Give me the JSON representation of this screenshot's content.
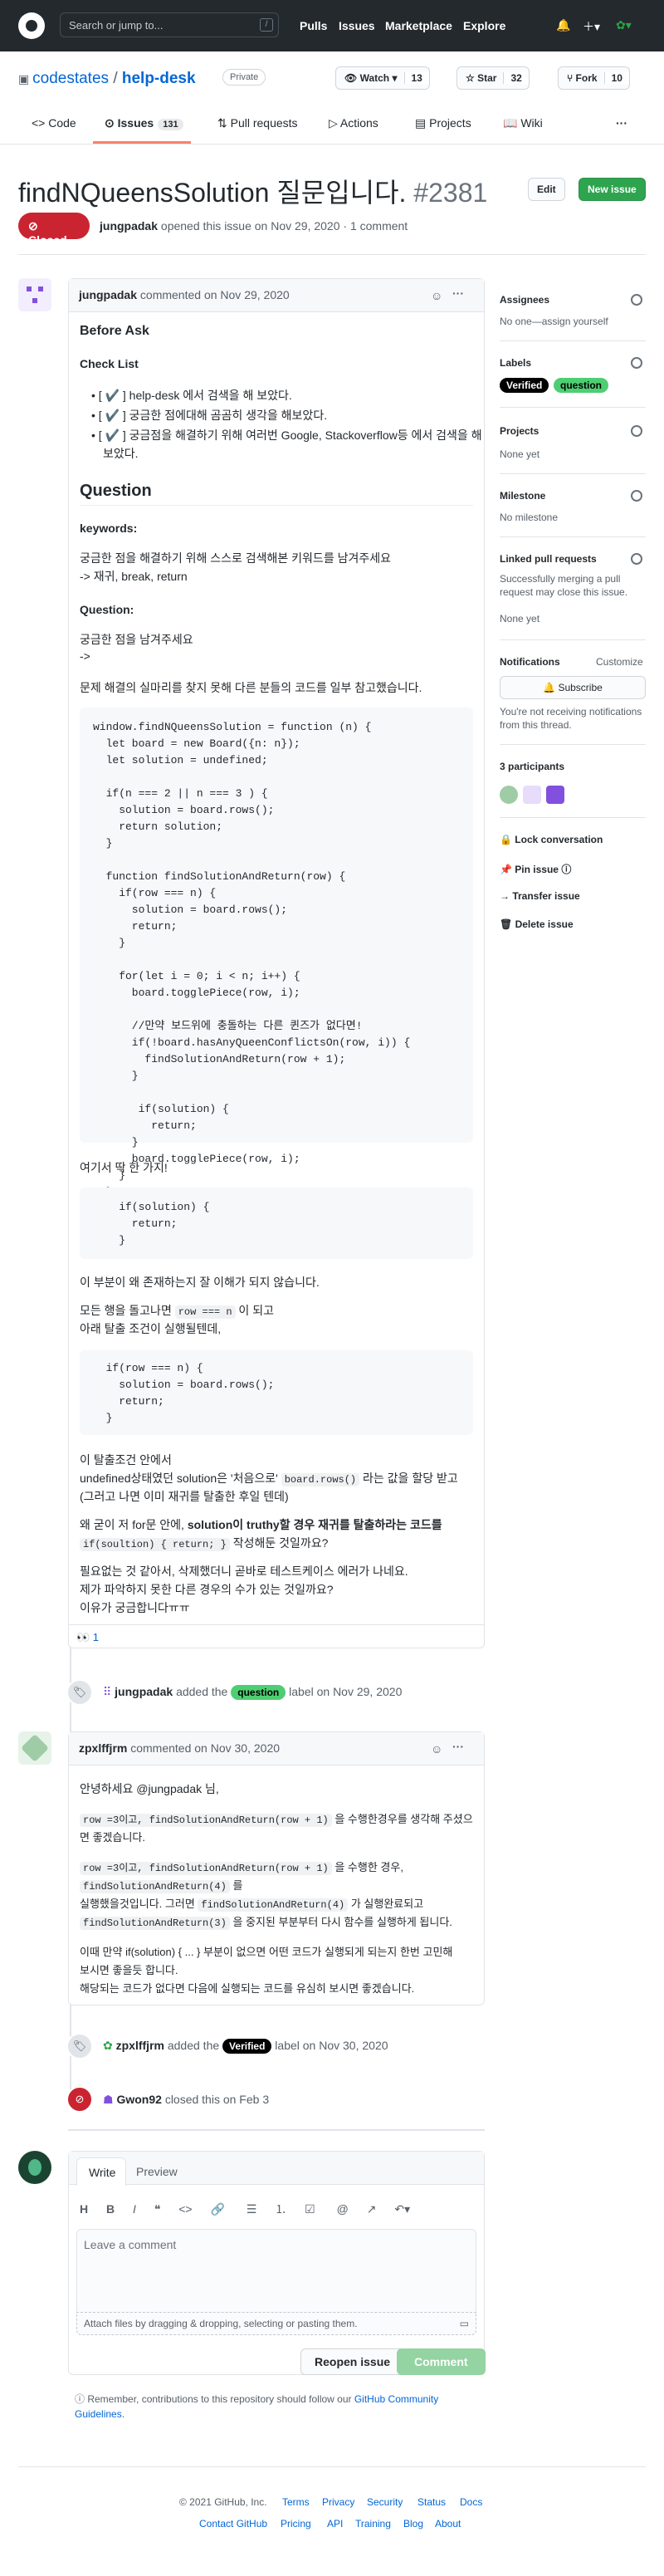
{
  "header": {
    "search_placeholder": "Search or jump to...",
    "slash": "/",
    "nav": [
      "Pulls",
      "Issues",
      "Marketplace",
      "Explore"
    ]
  },
  "repo": {
    "owner": "codestates",
    "name": "help-desk",
    "visibility": "Private",
    "watch_label": "Watch",
    "watch_count": "13",
    "star_label": "Star",
    "star_count": "32",
    "fork_label": "Fork",
    "fork_count": "10"
  },
  "tabs": {
    "code": "Code",
    "issues": "Issues",
    "issues_count": "131",
    "pulls": "Pull requests",
    "actions": "Actions",
    "projects": "Projects",
    "wiki": "Wiki"
  },
  "issue": {
    "title": "findNQueensSolution 질문입니다.",
    "number": "#2381",
    "edit": "Edit",
    "new_issue": "New issue",
    "state": "Closed",
    "author": "jungpadak",
    "meta_rest": "opened this issue on Nov 29, 2020 · 1 comment"
  },
  "comment1": {
    "author": "jungpadak",
    "header_rest": "commented on Nov 29, 2020",
    "before_ask": "Before Ask",
    "checklist": "Check List",
    "checks": [
      "[ ✔️ ] help-desk 에서 검색을 해 보았다.",
      "[ ✔️ ] 궁금한 점에대해 곰곰히 생각을 해보았다.",
      "[ ✔️ ] 궁금점을 해결하기 위해 여러번 Google, Stackoverflow등 에서 검색을 해",
      "보았다."
    ],
    "question": "Question",
    "keywords": "keywords:",
    "kw_1": "궁금한 점을 해결하기 위해 스스로 검색해본 키워드를 남겨주세요",
    "kw_2": "-> 재귀, break, return",
    "question2": "Question:",
    "q_1": "궁금한 점을 남겨주세요",
    "q_2": "->",
    "q_3": "문제 해결의 실마리를 찾지 못해 다른 분들의 코드를 일부 참고했습니다.",
    "code1": "window.findNQueensSolution = function (n) {\n  let board = new Board({n: n});\n  let solution = undefined;\n\n  if(n === 2 || n === 3 ) {\n    solution = board.rows();\n    return solution;\n  }\n\n  function findSolutionAndReturn(row) {\n    if(row === n) {\n      solution = board.rows();\n      return;\n    }\n\n    for(let i = 0; i < n; i++) {\n      board.togglePiece(row, i);\n\n      //만약 보드위에 충돌하는 다른 퀸즈가 없다면!\n      if(!board.hasAnyQueenConflictsOn(row, i)) {\n        findSolutionAndReturn(row + 1);\n      }\n\n       if(solution) {\n         return;\n      }\n      board.togglePiece(row, i);\n    }\n  }",
    "here": "여기서 딱 한 가지!",
    "code2": "    if(solution) {\n      return;\n    }",
    "why": "이 부분이 왜 존재하는지 잘 이해가 되지 않습니다.",
    "p1a": "모든 행을 돌고나면 ",
    "p1code": "row === n",
    "p1b": " 이 되고",
    "p1c": "아래 탈출 조건이 실행될텐데,",
    "code3": "  if(row === n) {\n    solution = board.rows();\n    return;\n  }",
    "p2a": "이 탈출조건 안에서",
    "p2b": "undefined상태였던 solution은 '처음으로' ",
    "p2code": "board.rows()",
    "p2c": " 라는 값을 할당 받고",
    "p2d": "(그러고 나면 이미 재귀를 탈출한 후일 텐데)",
    "p3a": "왜 굳이 저 for문 안에, ",
    "p3b": "solution이 truthy할 경우 재귀를 탈출하라는 코드를",
    "p3code": "if(soultion) { return; }",
    "p3c": " 작성해둔 것일까요?",
    "p4a": "필요없는 것 같아서, 삭제했더니 곧바로 테스트케이스 에러가 나네요.",
    "p4b": "제가 파악하지 못한 다른 경우의 수가 있는 것일까요?",
    "p4c": "이유가 궁금합니다ㅠㅠ",
    "reaction": "👀 1"
  },
  "event1": {
    "actor": "jungpadak",
    "pre": "added the",
    "label": "question",
    "post": "label on Nov 29, 2020"
  },
  "comment2": {
    "author": "zpxlffjrm",
    "header_rest": "commented on Nov 30, 2020",
    "l1": "안녕하세요 @jungpadak 님,",
    "l2code": "row =3이고, findSolutionAndReturn(row + 1)",
    "l2": " 을 수행한경우를 생각해 주셨으",
    "l2b": "면 좋겠습니다.",
    "l3code": "row =3이고, findSolutionAndReturn(row + 1)",
    "l3": " 을 수행한 경우,",
    "l3code2": "findSolutionAndReturn(4)",
    "l3b": " 를",
    "l3c": "실행했을것입니다. 그러면 ",
    "l3code3": "findSolutionAndReturn(4)",
    "l3d": " 가 실행완료되고",
    "l3code4": "findSolutionAndReturn(3)",
    "l3e": " 을 중지된 부분부터 다시 함수를 실행하게 됩니다.",
    "l4": "이때 만약 if(solution) { ... } 부분이 없으면 어떤 코드가 실행되게 되는지 한번 고민해",
    "l4b": "보시면 좋을듯 합니다.",
    "l4c": "해당되는 코드가 없다면 다음에 실행되는 코드를 유심히 보시면 좋겠습니다."
  },
  "event2": {
    "actor": "zpxlffjrm",
    "pre": "added the",
    "label": "Verified",
    "post": "label on Nov 30, 2020"
  },
  "event3": {
    "actor": "Gwon92",
    "text": "closed this on Feb 3"
  },
  "composer": {
    "write": "Write",
    "preview": "Preview",
    "placeholder": "Leave a comment",
    "attach": "Attach files by dragging & dropping, selecting or pasting them.",
    "reopen": "Reopen issue",
    "comment": "Comment",
    "remember": "Remember, contributions to this repository should follow our ",
    "guidelines": "GitHub Community",
    "guidelines2": "Guidelines."
  },
  "sidebar": {
    "assignees": "Assignees",
    "assignees_val": "No one—assign yourself",
    "labels": "Labels",
    "label_verified": "Verified",
    "label_question": "question",
    "projects": "Projects",
    "projects_val": "None yet",
    "milestone": "Milestone",
    "milestone_val": "No milestone",
    "linked": "Linked pull requests",
    "linked_val1": "Successfully merging a pull",
    "linked_val2": "request may close this issue.",
    "linked_val3": "None yet",
    "notifications": "Notifications",
    "customize": "Customize",
    "subscribe": "Subscribe",
    "notif_text1": "You're not receiving notifications",
    "notif_text2": "from this thread.",
    "participants": "3 participants",
    "lock": "Lock conversation",
    "pin": "Pin issue",
    "transfer": "Transfer issue",
    "delete": "Delete issue"
  },
  "footer": {
    "copyright": "© 2021 GitHub, Inc.",
    "row1": [
      "Terms",
      "Privacy",
      "Security",
      "Status",
      "Docs"
    ],
    "row2": [
      "Contact GitHub",
      "Pricing",
      "API",
      "Training",
      "Blog",
      "About"
    ]
  },
  "colors": {
    "header_bg": "#24292e",
    "closed_red": "#cb2431",
    "new_issue_green": "#2ea44f",
    "link_blue": "#0366d6",
    "question_label": "#4ece72",
    "verified_label": "#000000"
  }
}
